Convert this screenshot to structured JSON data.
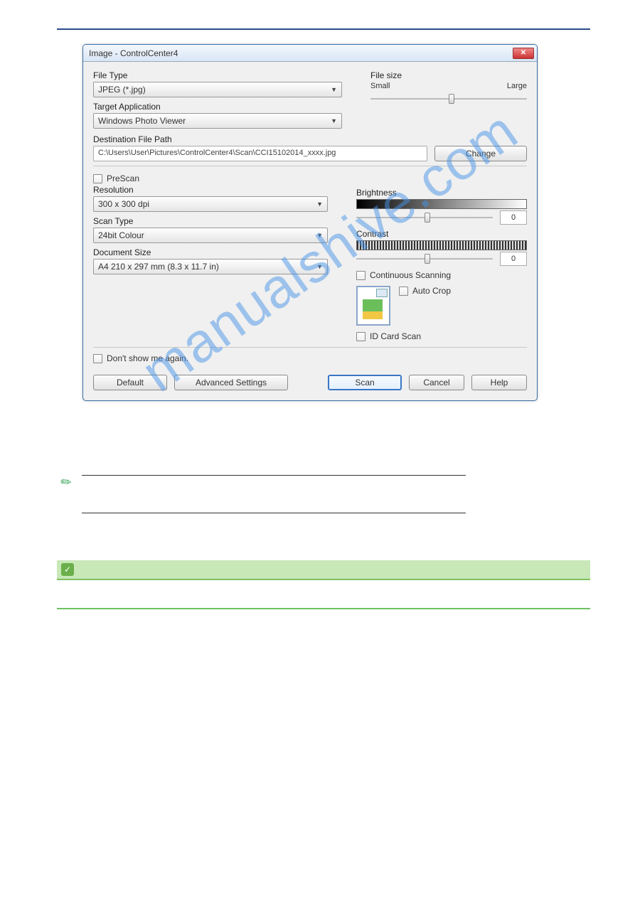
{
  "dialog": {
    "title": "Image - ControlCenter4",
    "file_type_label": "File Type",
    "file_type_value": "JPEG (*.jpg)",
    "target_app_label": "Target Application",
    "target_app_value": "Windows Photo Viewer",
    "dest_label": "Destination File Path",
    "dest_value": "C:\\Users\\User\\Pictures\\ControlCenter4\\Scan\\CCI15102014_xxxx.jpg",
    "change_btn": "Change",
    "file_size_label": "File size",
    "file_size_small": "Small",
    "file_size_large": "Large",
    "prescan": "PreScan",
    "resolution_label": "Resolution",
    "resolution_value": "300 x 300 dpi",
    "scantype_label": "Scan Type",
    "scantype_value": "24bit Colour",
    "docsize_label": "Document Size",
    "docsize_value": "A4 210 x 297 mm (8.3 x 11.7 in)",
    "brightness_label": "Brightness",
    "brightness_value": "0",
    "contrast_label": "Contrast",
    "contrast_value": "0",
    "continuous": "Continuous Scanning",
    "autocrop": "Auto Crop",
    "idcard": "ID Card Scan",
    "dontshow": "Don't show me again.",
    "btn_default": "Default",
    "btn_advanced": "Advanced Settings",
    "btn_scan": "Scan",
    "btn_cancel": "Cancel",
    "btn_help": "Help"
  },
  "note": {
    "line1": "",
    "line2": ""
  }
}
